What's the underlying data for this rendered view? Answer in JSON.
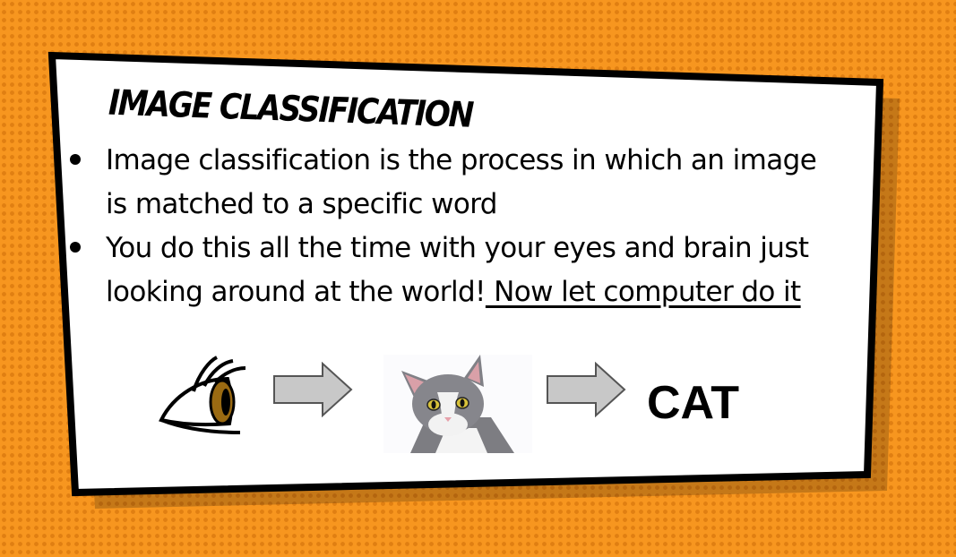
{
  "slide": {
    "title": "Image classification",
    "bullets": [
      {
        "text": "Image classification is the process in which an image is matched to a specific word",
        "link_text": ""
      },
      {
        "text": "You do this all the time with your eyes and brain just looking around at the world!",
        "link_text": " Now let computer do it"
      }
    ],
    "result_label": "CAT",
    "colors": {
      "background": "#f7961f",
      "dots": "#e07f12",
      "card": "#ffffff",
      "border": "#000000",
      "arrow_fill": "#c8c8c8"
    },
    "icons": [
      "eye-icon",
      "arrow-right-icon",
      "cat-photo"
    ]
  }
}
